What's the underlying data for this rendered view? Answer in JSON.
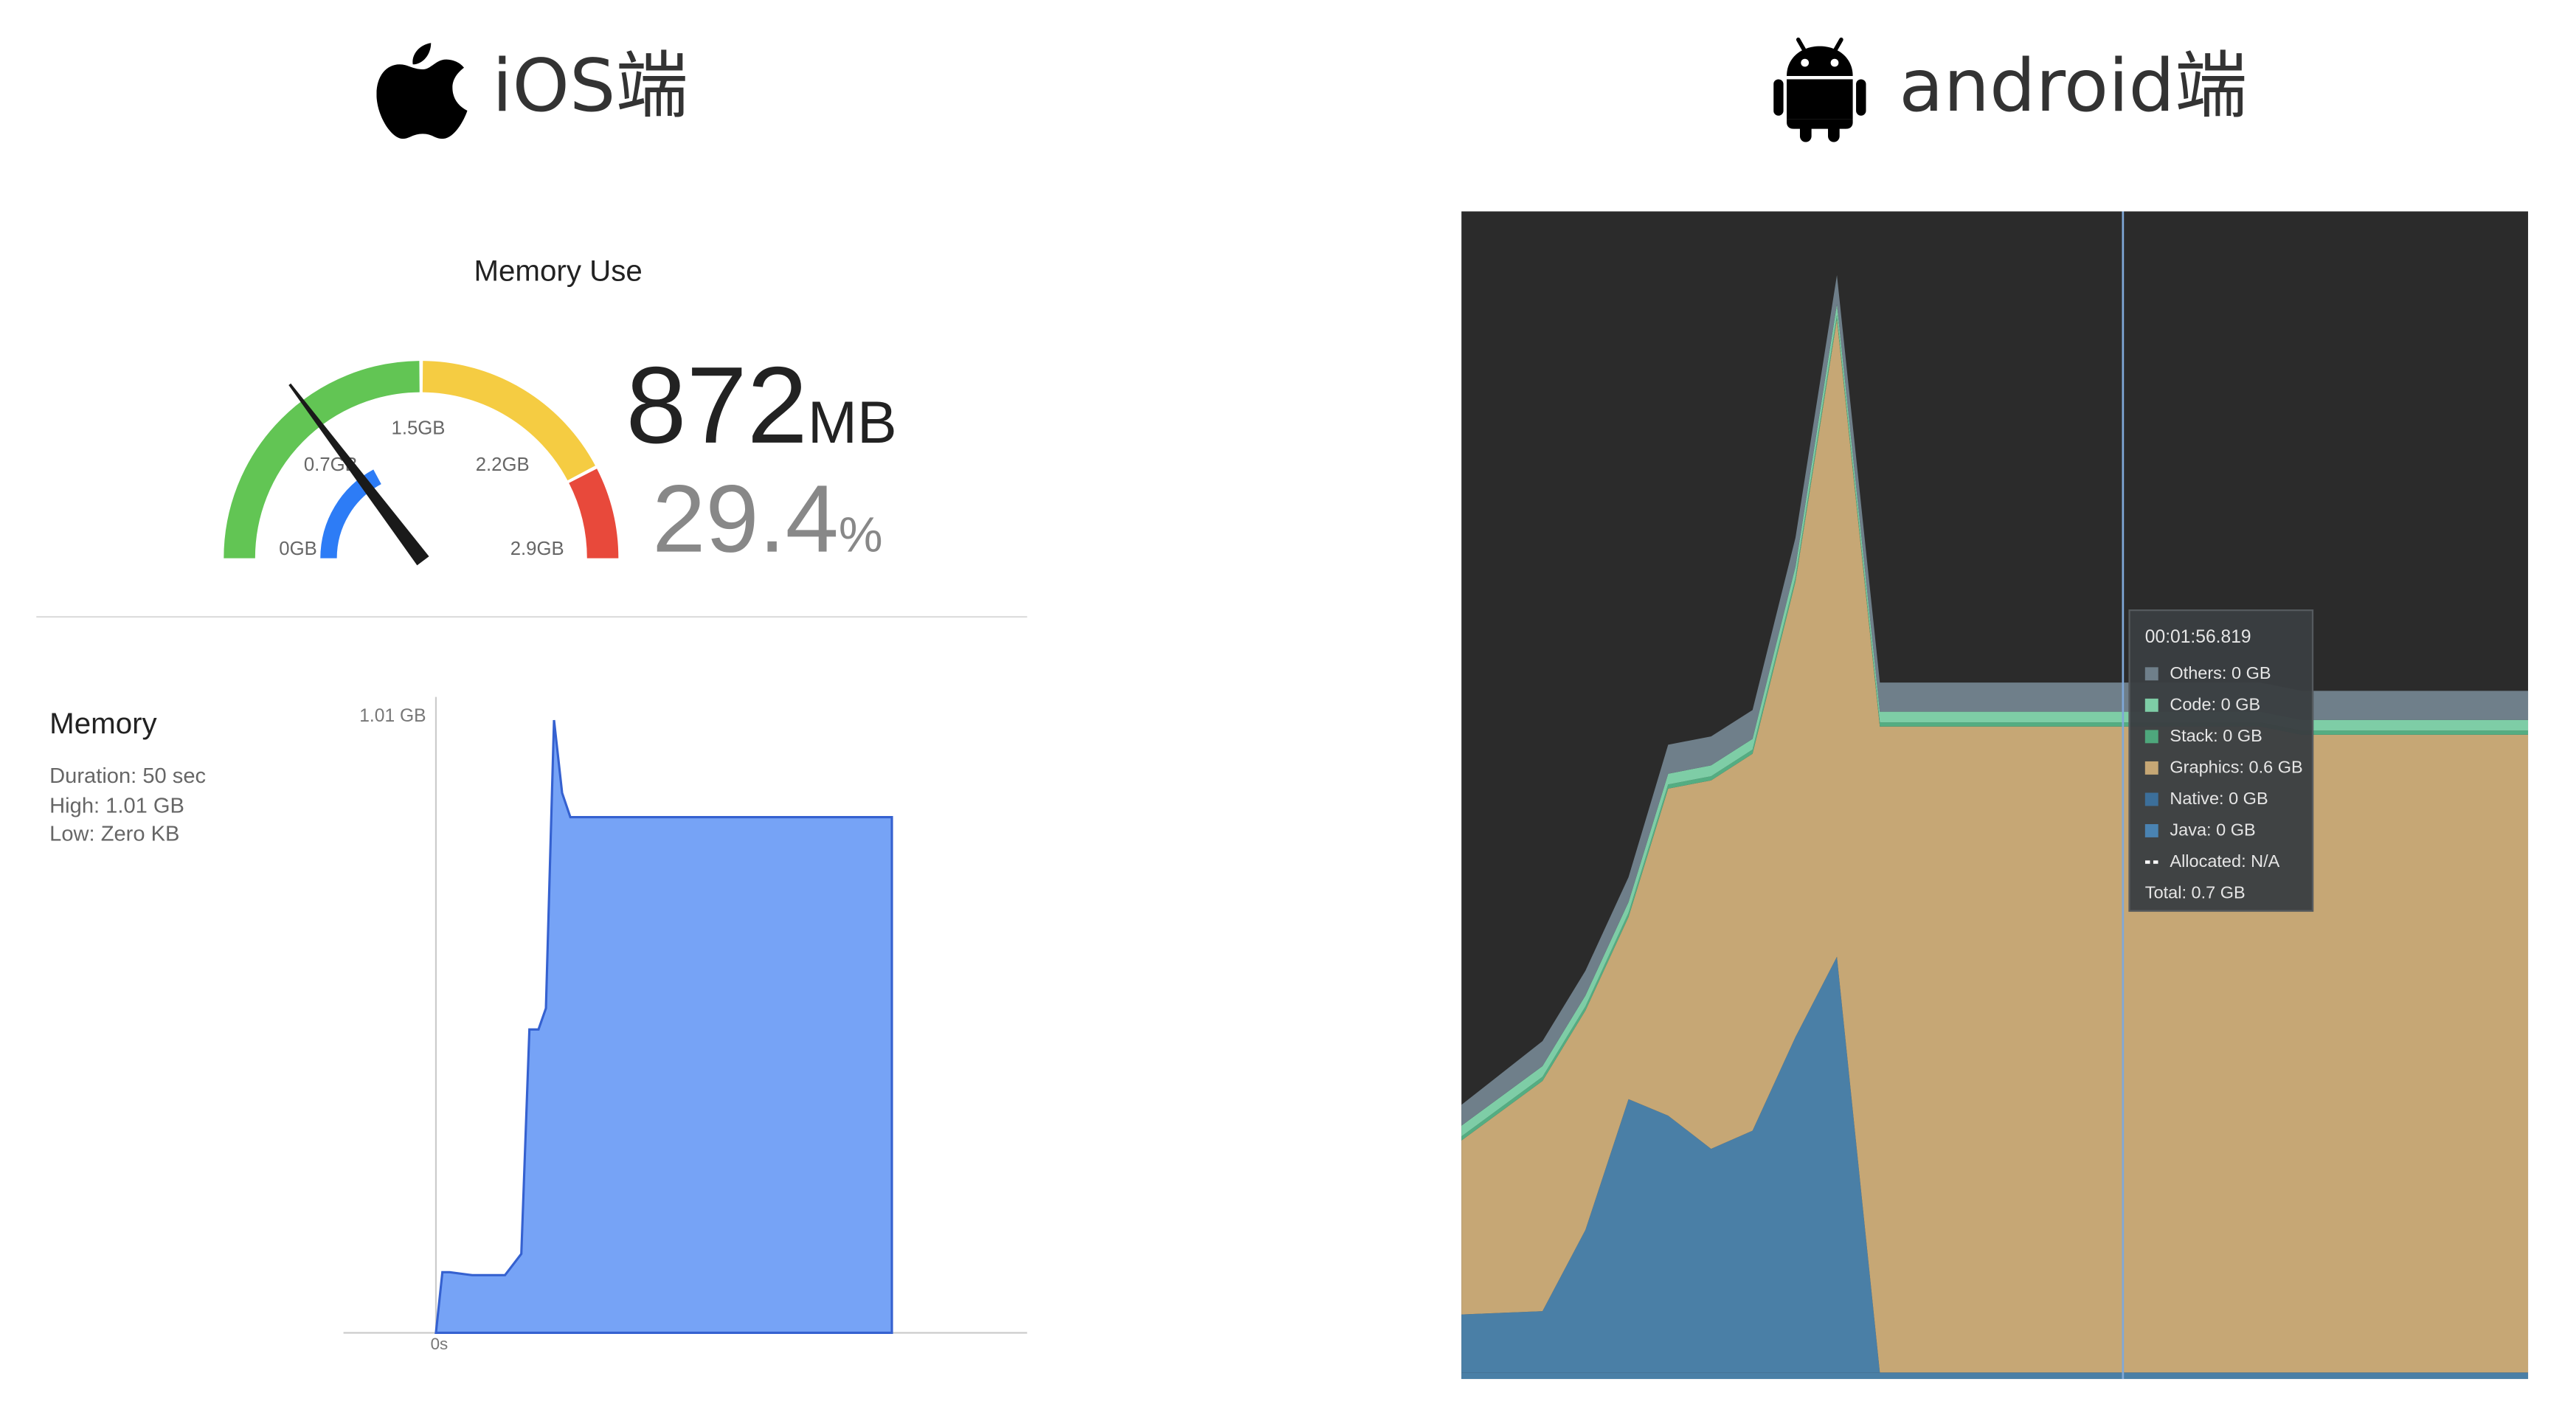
{
  "ios": {
    "title": "iOS端",
    "gauge": {
      "title": "Memory Use",
      "value_number": "872",
      "value_unit": "MB",
      "percent_number": "29.4",
      "percent_unit": "%",
      "needle_fraction": 0.294,
      "app_fraction": 0.294,
      "labels": {
        "l0": "0GB",
        "l1": "0.7GB",
        "l2": "1.5GB",
        "l3": "2.2GB",
        "l4": "2.9GB"
      },
      "colors": {
        "green": "#62c554",
        "yellow": "#f5cc42",
        "red": "#e8493b",
        "blue": "#2d7cf6",
        "needle": "#1a1a1a"
      }
    },
    "memory_report": {
      "title": "Memory",
      "duration": "Duration: 50 sec",
      "high": "High: 1.01 GB",
      "low": "Low: Zero KB"
    }
  },
  "android": {
    "title": "android端",
    "tooltip": {
      "time": "00:01:56.819",
      "rows": [
        {
          "label": "Others: 0 GB",
          "color": "#6f7f8a",
          "kind": "square"
        },
        {
          "label": "Code: 0 GB",
          "color": "#7ecda6",
          "kind": "square"
        },
        {
          "label": "Stack: 0 GB",
          "color": "#4ea77c",
          "kind": "square"
        },
        {
          "label": "Graphics: 0.6 GB",
          "color": "#c6a775",
          "kind": "square"
        },
        {
          "label": "Native: 0 GB",
          "color": "#3c6f9a",
          "kind": "square"
        },
        {
          "label": "Java: 0 GB",
          "color": "#4a83b2",
          "kind": "square"
        },
        {
          "label": "Allocated: N/A",
          "color": "#ffffff",
          "kind": "dash"
        }
      ],
      "total": "Total: 0.7 GB"
    }
  },
  "chart_data": [
    {
      "type": "area",
      "title": "",
      "xlabel": "",
      "ylabel": "",
      "y_tick_labels": [
        "1.01 GB"
      ],
      "x_tick_labels": [
        "0s"
      ],
      "ylim": [
        0,
        1.01
      ],
      "xlim": [
        0,
        50
      ],
      "grid": false,
      "color": "#76a3f6",
      "stroke": "#3561d0",
      "series": [
        {
          "x": [
            0,
            0.7,
            1.5,
            4.0,
            7.6,
            9.4,
            10.3,
            11.3,
            12.1,
            13.0,
            13.9,
            14.8,
            15.8,
            50.2,
            50.2
          ],
          "y": [
            0,
            0.1,
            0.1,
            0.095,
            0.095,
            0.13,
            0.5,
            0.5,
            0.535,
            1.01,
            0.89,
            0.85,
            0.85,
            0.85,
            0
          ]
        }
      ]
    },
    {
      "type": "area",
      "title": "",
      "xlabel": "",
      "ylabel": "",
      "grid": false,
      "stacked": true,
      "background": "#2b2b2b",
      "x": [
        0,
        49,
        75,
        101,
        125,
        151,
        176,
        202,
        227,
        253,
        400,
        483,
        508,
        645
      ],
      "series": [
        {
          "name": "Java",
          "color": "#4a7fa6",
          "values": [
            0.08,
            0.08,
            0.08,
            0.08,
            0.08,
            0.08,
            0.08,
            0.08,
            0.08,
            0.08,
            0.08,
            0.08,
            0.08,
            0.08
          ]
        },
        {
          "name": "Native",
          "color": "#4a7fa6",
          "values": [
            0.7,
            0.74,
            1.72,
            3.3,
            3.1,
            2.7,
            2.92,
            4.05,
            5.02,
            0,
            0,
            0,
            0,
            0
          ]
        },
        {
          "name": "Graphics",
          "color": "#c6a775",
          "values": [
            2.1,
            2.78,
            2.65,
            2.2,
            3.95,
            4.45,
            4.55,
            5.5,
            7.7,
            7.8,
            7.8,
            7.8,
            7.7,
            7.7
          ]
        },
        {
          "name": "Stack",
          "color": "#54ad82",
          "values": [
            0.05,
            0.05,
            0.05,
            0.05,
            0.05,
            0.05,
            0.05,
            0.05,
            0.05,
            0.05,
            0.05,
            0.05,
            0.05,
            0.05
          ]
        },
        {
          "name": "Code",
          "color": "#7ecda6",
          "values": [
            0.13,
            0.13,
            0.13,
            0.13,
            0.13,
            0.13,
            0.13,
            0.13,
            0.13,
            0.13,
            0.13,
            0.13,
            0.13,
            0.13
          ]
        },
        {
          "name": "Others",
          "color": "#6f7f8a",
          "values": [
            0.25,
            0.3,
            0.3,
            0.3,
            0.35,
            0.35,
            0.35,
            0.35,
            0.35,
            0.35,
            0.35,
            0.35,
            0.35,
            0.35
          ]
        }
      ],
      "ylim": [
        0,
        14.1
      ],
      "xlim": [
        0,
        645
      ],
      "cursor_x": 400
    }
  ]
}
